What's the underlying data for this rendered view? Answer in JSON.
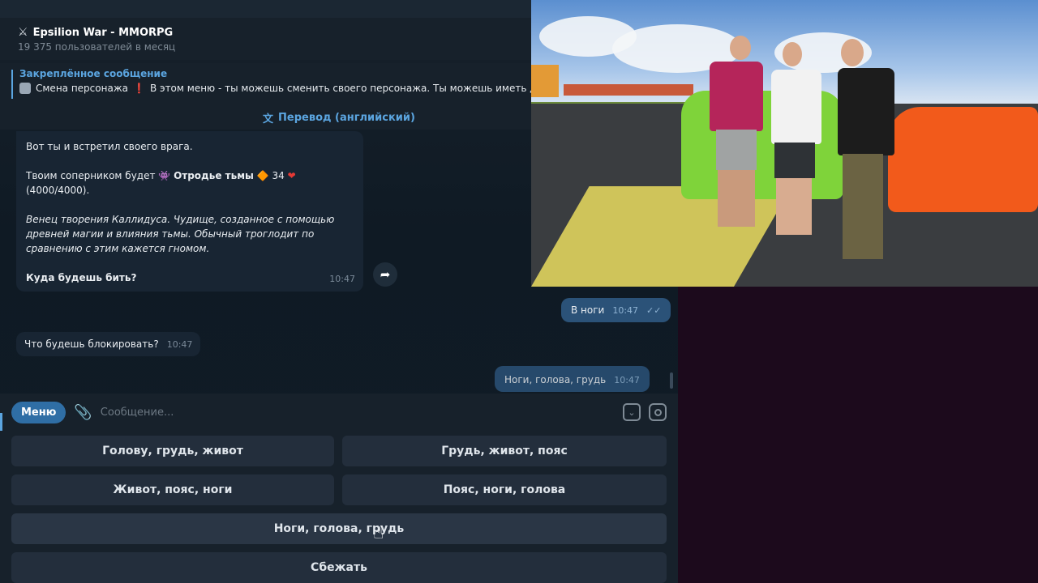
{
  "header": {
    "title": "Epsilion War - MMORPG",
    "subtitle": "19 375 пользователей в месяц"
  },
  "pinned": {
    "title": "Закреплённое сообщение",
    "text": "Смена персонажа",
    "text_rest": "В этом меню - ты можешь сменить своего персонажа. Ты можешь иметь д"
  },
  "translate_label": "Перевод (английский)",
  "messages": {
    "enemy": {
      "line1": "Вот ты и встретил своего врага.",
      "line2_prefix": "Твоим соперником будет",
      "enemy_name": "Отродье тьмы",
      "level": "34",
      "hp": "(4000/4000).",
      "desc": "Венец творения Каллидуса. Чудище, созданное с помощью древней магии и влияния тьмы. Обычный троглодит по сравнению с этим кажется гномом.",
      "question": "Куда будешь бить?",
      "time": "10:47"
    },
    "out1": {
      "text": "В ноги",
      "time": "10:47"
    },
    "in2": {
      "text": "Что будешь блокировать?",
      "time": "10:47"
    },
    "out2": {
      "text": "Ноги, голова, грудь",
      "time": "10:47"
    }
  },
  "composer": {
    "menu_label": "Меню",
    "placeholder": "Сообщение..."
  },
  "keyboard": {
    "b1": "Голову, грудь, живот",
    "b2": "Грудь, живот, пояс",
    "b3": "Живот, пояс, ноги",
    "b4": "Пояс, ноги, голова",
    "b5": "Ноги, голова, грудь",
    "b6": "Сбежать"
  },
  "colors": {
    "chat_bg": "#0e1621",
    "accent": "#5ba5e0",
    "outgoing": "#2b5278",
    "incoming": "#182533"
  }
}
